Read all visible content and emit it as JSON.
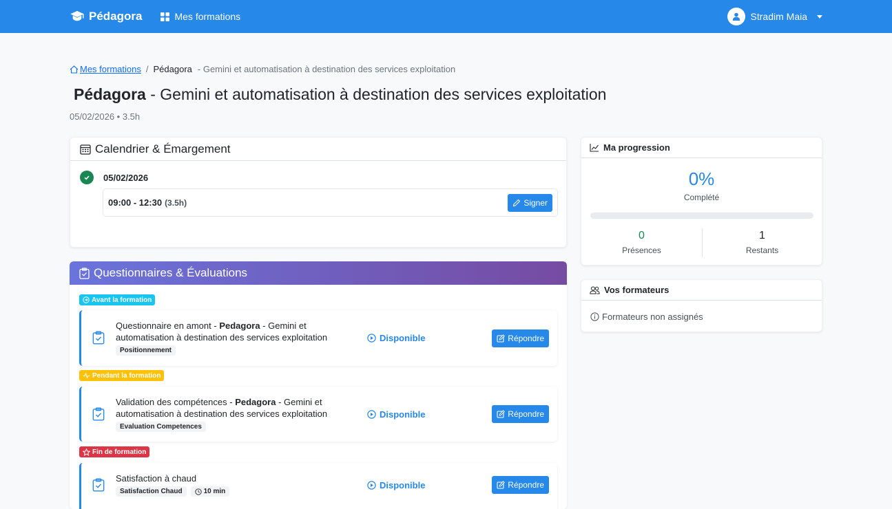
{
  "nav": {
    "brand": "Pédagora",
    "link": "Mes formations",
    "user": "Stradim Maia"
  },
  "breadcrumb": {
    "home": "Mes formations",
    "sep": "/",
    "current": "Pédagora",
    "rest": "- Gemini et automatisation à destination des services exploitation"
  },
  "page": {
    "title_bold": "Pédagora",
    "title_rest": " - Gemini et automatisation à destination des services exploitation",
    "meta": "05/02/2026 • 3.5h"
  },
  "calendar": {
    "title": "Calendrier & Émargement",
    "date": "05/02/2026",
    "time": "09:00 - 12:30",
    "duration": "(3.5h)",
    "sign_label": "Signer"
  },
  "quiz": {
    "title": "Questionnaires & Évaluations",
    "phases": {
      "before": "Avant la formation",
      "during": "Pendant la formation",
      "end": "Fin de formation"
    },
    "items": [
      {
        "title_a": "Questionnaire en amont - ",
        "title_bold": "Pedagora",
        "title_b": " - Gemini et automatisation à destination des services exploitation",
        "tag": "Positionnement",
        "status": "Disponible",
        "action": "Répondre"
      },
      {
        "title_a": "Validation des compétences - ",
        "title_bold": "Pedagora",
        "title_b": " - Gemini et automatisation à destination des services exploitation",
        "tag": "Evaluation Competences",
        "status": "Disponible",
        "action": "Répondre"
      },
      {
        "title_a": "Satisfaction à chaud",
        "tag": "Satisfaction Chaud",
        "time_tag": "10 min",
        "status": "Disponible",
        "action": "Répondre"
      }
    ]
  },
  "progress": {
    "title": "Ma progression",
    "percent_label": "0%",
    "percent_value": 0,
    "complete_label": "Complété",
    "presences": "0",
    "presences_label": "Présences",
    "remaining": "1",
    "remaining_label": "Restants",
    "colors": {
      "accent": "#2688e8",
      "success": "#198754"
    }
  },
  "trainers": {
    "title": "Vos formateurs",
    "empty": "Formateurs non assignés"
  }
}
